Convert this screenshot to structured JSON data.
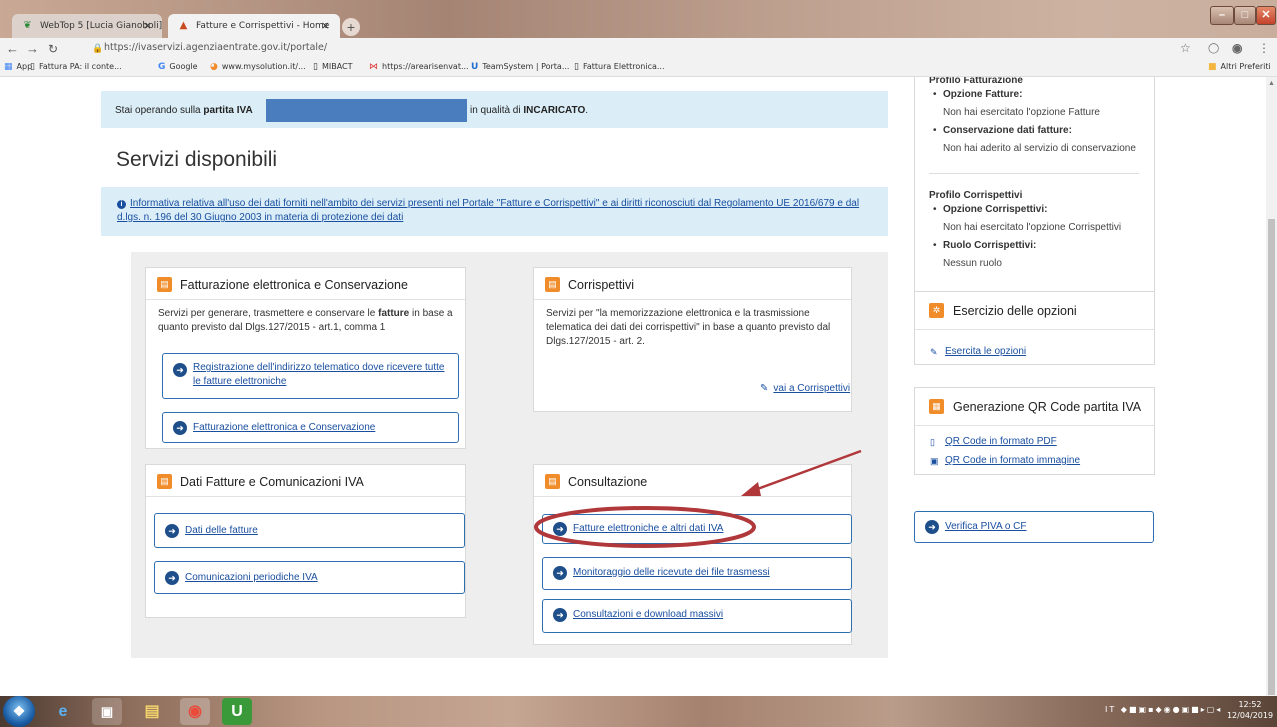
{
  "browser": {
    "tabs": [
      {
        "label": "WebTop 5 [Lucia Gianoboli]",
        "icon": "webtop-icon"
      },
      {
        "label": "Fatture e Corrispettivi - Home",
        "icon": "agenzia-entrate-icon",
        "active": true
      }
    ],
    "url": "https://ivaservizi.agenziaentrate.gov.it/portale/",
    "bookmarks": [
      {
        "label": "App"
      },
      {
        "label": "Fattura PA: il conte..."
      },
      {
        "label": "Google"
      },
      {
        "label": "www.mysolution.it/..."
      },
      {
        "label": "MIBACT"
      },
      {
        "label": "https://arearisenvat..."
      },
      {
        "label": "TeamSystem | Porta..."
      },
      {
        "label": "Fattura Elettronica..."
      }
    ],
    "other_bookmarks": "Altri Preferiti"
  },
  "page": {
    "operating_text_before": "Stai operando sulla ",
    "operating_bold": "partita IVA",
    "operating_text_after": "in qualità di ",
    "operating_role": "INCARICATO",
    "title": "Servizi disponibili",
    "privacy_link": "Informativa relativa all'uso dei dati forniti nell'ambito dei servizi presenti nel Portale \"Fatture e Corrispettivi\" e ai diritti riconosciuti dal Regolamento UE 2016/679 e dal d.lgs. n. 196 del 30 Giugno 2003 in materia di protezione dei dati",
    "cards": {
      "fatturazione": {
        "title": "Fatturazione elettronica e Conservazione",
        "desc_pre": "Servizi per generare, trasmettere e conservare le ",
        "desc_bold": "fatture",
        "desc_post": " in base a quanto previsto dal Dlgs.127/2015 - art.1, comma 1",
        "links": [
          "Registrazione dell'indirizzo telematico dove ricevere tutte le fatture elettroniche",
          "Fatturazione elettronica e Conservazione"
        ]
      },
      "corrispettivi": {
        "title": "Corrispettivi",
        "desc": "Servizi per \"la memorizzazione elettronica e la trasmissione telematica dei dati dei corrispettivi\" in base a quanto previsto dal Dlgs.127/2015 - art. 2.",
        "link": "vai a Corrispettivi"
      },
      "dati_fatture": {
        "title": "Dati Fatture e Comunicazioni IVA",
        "links": [
          "Dati delle fatture",
          "Comunicazioni periodiche IVA"
        ]
      },
      "consultazione": {
        "title": "Consultazione",
        "links": [
          "Fatture elettroniche e altri dati IVA",
          "Monitoraggio delle ricevute dei file trasmessi",
          "Consultazioni e download massivi"
        ]
      }
    },
    "sidebar": {
      "profilo_fatturazione": {
        "title": "Profilo Fatturazione",
        "items": [
          {
            "label": "Opzione Fatture:",
            "value": "Non hai esercitato l'opzione Fatture"
          },
          {
            "label": "Conservazione dati fatture:",
            "value": "Non hai aderito al servizio di conservazione"
          }
        ]
      },
      "profilo_corrispettivi": {
        "title": "Profilo Corrispettivi",
        "items": [
          {
            "label": "Opzione Corrispettivi:",
            "value": "Non hai esercitato l'opzione Corrispettivi"
          },
          {
            "label": "Ruolo Corrispettivi:",
            "value": "Nessun ruolo"
          }
        ]
      },
      "opzioni": {
        "title": "Esercizio delle opzioni",
        "link": "Esercita le opzioni"
      },
      "qr": {
        "title": "Generazione QR Code partita IVA",
        "links": [
          "QR Code in formato PDF",
          "QR Code in formato immagine"
        ]
      },
      "verifica": "Verifica PIVA o CF"
    }
  },
  "taskbar": {
    "time": "12:52",
    "date": "12/04/2019",
    "lang": "IT"
  },
  "colors": {
    "accent_orange": "#f08c2a",
    "link_blue": "#1a4fa0",
    "info_bg": "#dbeef7",
    "annotation_red": "#b0373a"
  }
}
